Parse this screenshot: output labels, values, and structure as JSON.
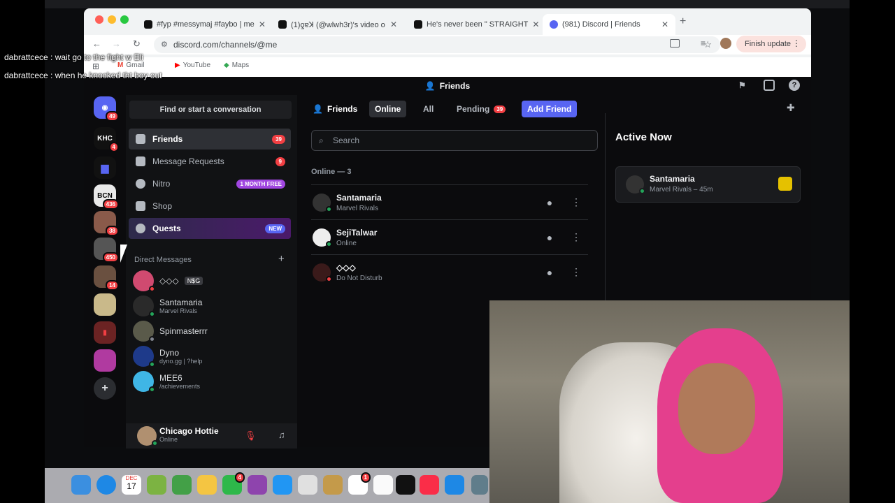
{
  "browser": {
    "tabs": [
      {
        "label": "#fyp #messymaj #faybo | me"
      },
      {
        "label": "(1)ƍɐꓘ (@wlwh3r)'s video o"
      },
      {
        "label": "He's never been \" STRAIGHT"
      },
      {
        "label": "(981) Discord | Friends"
      }
    ],
    "url": "discord.com/channels/@me",
    "finish_update": "Finish update",
    "bookmarks": [
      "Gmail",
      "YouTube",
      "Maps"
    ]
  },
  "overlay_chat": [
    "dabrattcece : wait go to the fight w Eli",
    "dabrattcece : when he knocked tht boy out"
  ],
  "discord": {
    "window_title": "Friends",
    "servers": [
      {
        "label": "",
        "badge": "49"
      },
      {
        "label": "KHC",
        "badge": "4"
      },
      {
        "label": "",
        "badge": ""
      },
      {
        "label": "BCN",
        "badge": "436"
      },
      {
        "label": "",
        "badge": "38"
      },
      {
        "label": "",
        "badge": "450"
      },
      {
        "label": "",
        "badge": "14"
      },
      {
        "label": "",
        "badge": ""
      },
      {
        "label": "",
        "badge": ""
      },
      {
        "label": "",
        "badge": ""
      }
    ],
    "find_conversation": "Find or start a conversation",
    "nav": [
      {
        "label": "Friends",
        "tag": "39"
      },
      {
        "label": "Message Requests",
        "tag": "9"
      },
      {
        "label": "Nitro",
        "tag": "1 MONTH FREE"
      },
      {
        "label": "Shop",
        "tag": ""
      },
      {
        "label": "Quests",
        "tag": "NEW"
      }
    ],
    "dm_header": "Direct Messages",
    "dms": [
      {
        "name": "◇◇◇",
        "sub": "",
        "tag": "N$G"
      },
      {
        "name": "Santamaria",
        "sub": "Marvel Rivals"
      },
      {
        "name": "Spinmasterrr",
        "sub": ""
      },
      {
        "name": "Dyno",
        "sub": "dyno.gg | ?help"
      },
      {
        "name": "MEE6",
        "sub": "/achievements"
      }
    ],
    "user": {
      "name": "Chicago Hottie",
      "status": "Online"
    },
    "tabbar": {
      "title": "Friends",
      "online": "Online",
      "all": "All",
      "pending": "Pending",
      "pending_count": "39",
      "add_friend": "Add Friend"
    },
    "search_placeholder": "Search",
    "online_header": "Online — 3",
    "friends": [
      {
        "name": "Santamaria",
        "sub": "Marvel Rivals",
        "status_color": "#23a55a"
      },
      {
        "name": "SejiTalwar",
        "sub": "Online",
        "status_color": "#23a55a"
      },
      {
        "name": "◇◇◇",
        "sub": "Do Not Disturb",
        "status_color": "#f23f43"
      }
    ],
    "active_now": {
      "title": "Active Now",
      "name": "Santamaria",
      "activity": "Marvel Rivals – 45m"
    }
  },
  "dock_badges": {
    "facetime": "4",
    "reminders": "1"
  },
  "dock_calendar": {
    "month": "DEC",
    "day": "17"
  }
}
